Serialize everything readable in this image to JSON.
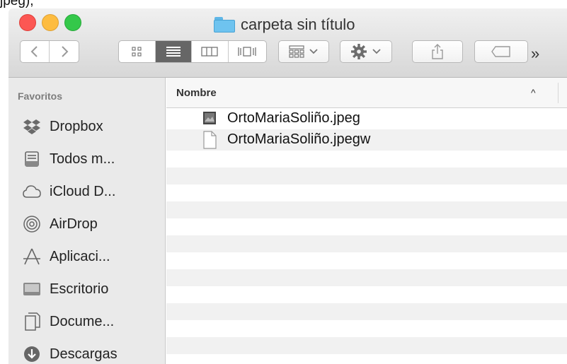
{
  "window": {
    "title": "carpeta sin título",
    "folder_color": "#6ec3ef"
  },
  "top_crop_text": "jpeg),",
  "toolbar": {
    "back_icon": "chevron-left-icon",
    "forward_icon": "chevron-right-icon",
    "view_modes": [
      "icon-view-icon",
      "list-view-icon",
      "column-view-icon",
      "cover-flow-icon"
    ],
    "active_view": "list-view-icon",
    "arrange_icon": "arrange-grid-icon",
    "action_icon": "gear-icon",
    "share_icon": "share-icon",
    "tag_icon": "tag-icon",
    "overflow_label": "»"
  },
  "sidebar": {
    "header": "Favoritos",
    "items": [
      {
        "label": "Dropbox",
        "icon": "dropbox-icon"
      },
      {
        "label": "Todos m...",
        "icon": "all-files-icon"
      },
      {
        "label": "iCloud D...",
        "icon": "cloud-icon"
      },
      {
        "label": "AirDrop",
        "icon": "airdrop-icon"
      },
      {
        "label": "Aplicaci...",
        "icon": "applications-icon"
      },
      {
        "label": "Escritorio",
        "icon": "desktop-icon"
      },
      {
        "label": "Docume...",
        "icon": "documents-icon"
      },
      {
        "label": "Descargas",
        "icon": "downloads-icon"
      }
    ]
  },
  "list": {
    "column_header": "Nombre",
    "sort_indicator": "^",
    "files": [
      {
        "name": "OrtoMariaSoliño.jpeg",
        "icon": "image-file-icon"
      },
      {
        "name": "OrtoMariaSoliño.jpegw",
        "icon": "document-file-icon"
      }
    ]
  },
  "colors": {
    "close": "#fc5753",
    "minimize": "#fdbc40",
    "maximize": "#34c84a",
    "active_view_bg": "#666666"
  }
}
